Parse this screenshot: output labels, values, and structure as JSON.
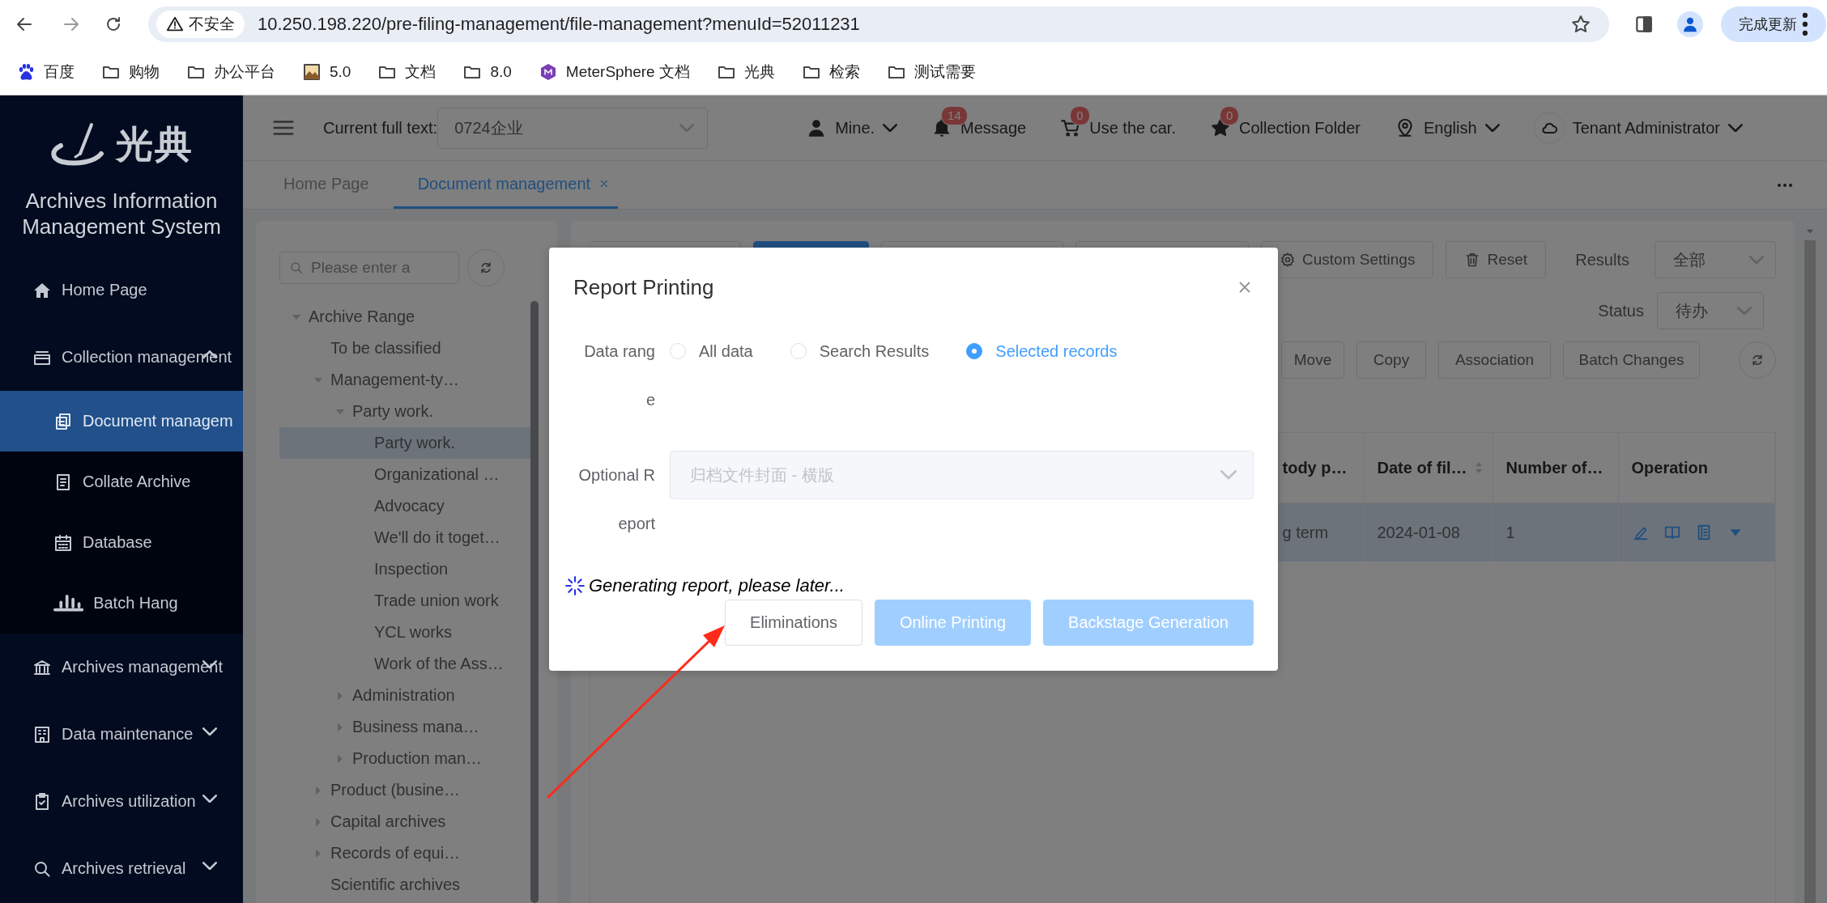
{
  "browser": {
    "security_label": "不安全",
    "url": "10.250.198.220/pre-filing-management/file-management?menuId=52011231",
    "update_button": "完成更新"
  },
  "bookmarks": [
    {
      "label": "百度",
      "kind": "baidu"
    },
    {
      "label": "购物",
      "kind": "folder"
    },
    {
      "label": "办公平台",
      "kind": "folder"
    },
    {
      "label": "5.0",
      "kind": "image"
    },
    {
      "label": "文档",
      "kind": "folder"
    },
    {
      "label": "8.0",
      "kind": "folder"
    },
    {
      "label": "MeterSphere 文档",
      "kind": "app"
    },
    {
      "label": "光典",
      "kind": "folder"
    },
    {
      "label": "检索",
      "kind": "folder"
    },
    {
      "label": "测试需要",
      "kind": "folder"
    }
  ],
  "sidebar": {
    "logo_text": "光典",
    "system_title": "Archives Information Management System",
    "menu": [
      {
        "label": "Home Page",
        "selected": false
      },
      {
        "label": "Collection management",
        "selected": false,
        "expanded": true,
        "children": [
          {
            "label": "Document managem",
            "selected": true
          },
          {
            "label": "Collate Archive",
            "selected": false
          },
          {
            "label": "Database",
            "selected": false
          },
          {
            "label": "Batch Hang",
            "selected": false
          }
        ]
      },
      {
        "label": "Archives management",
        "selected": false,
        "expanded": false
      },
      {
        "label": "Data maintenance",
        "selected": false,
        "expanded": false
      },
      {
        "label": "Archives utilization",
        "selected": false,
        "expanded": false
      },
      {
        "label": "Archives retrieval",
        "selected": false,
        "expanded": false
      }
    ]
  },
  "header": {
    "current_label": "Current full text:",
    "current_value": "0724企业",
    "items": [
      {
        "kind": "user",
        "label": "Mine.",
        "dropdown": true
      },
      {
        "kind": "bell",
        "label": "Message",
        "badge": "14",
        "dropdown": false
      },
      {
        "kind": "cart",
        "label": "Use the car.",
        "badge": "0",
        "dropdown": false
      },
      {
        "kind": "star",
        "label": "Collection Folder",
        "badge": "0",
        "dropdown": false
      },
      {
        "kind": "location",
        "label": "English",
        "dropdown": true
      },
      {
        "kind": "cloud",
        "label": "Tenant Administrator",
        "dropdown": true
      }
    ]
  },
  "tabs": [
    {
      "label": "Home Page",
      "selected": false,
      "closable": false
    },
    {
      "label": "Document management",
      "selected": true,
      "closable": true
    }
  ],
  "tree": {
    "search_placeholder": "Please enter a",
    "nodes": [
      {
        "label": "Archive Range",
        "selected": false,
        "expanded": true,
        "children": [
          {
            "label": "To be classified",
            "selected": false
          },
          {
            "label": "Management-ty…",
            "selected": false,
            "expanded": true,
            "children": [
              {
                "label": "Party work.",
                "selected": false,
                "expanded": true,
                "children": [
                  {
                    "label": "Party work.",
                    "selected": true
                  },
                  {
                    "label": "Organizational …",
                    "selected": false
                  },
                  {
                    "label": "Advocacy",
                    "selected": false
                  },
                  {
                    "label": "We'll do it toget…",
                    "selected": false
                  },
                  {
                    "label": "Inspection",
                    "selected": false
                  },
                  {
                    "label": "Trade union work",
                    "selected": false
                  },
                  {
                    "label": "YCL works",
                    "selected": false
                  },
                  {
                    "label": "Work of the Ass…",
                    "selected": false
                  }
                ]
              },
              {
                "label": "Administration",
                "selected": false,
                "expanded": false
              },
              {
                "label": "Business mana…",
                "selected": false,
                "expanded": false
              },
              {
                "label": "Production man…",
                "selected": false,
                "expanded": false
              }
            ]
          },
          {
            "label": "Product (busine…",
            "selected": false,
            "expanded": false
          },
          {
            "label": "Capital archives",
            "selected": false,
            "expanded": false
          },
          {
            "label": "Records of equi…",
            "selected": false,
            "expanded": false
          },
          {
            "label": "Scientific archives",
            "selected": false
          }
        ]
      }
    ]
  },
  "toolbar": {
    "buttons": [
      "Custom Settings",
      "Reset"
    ],
    "filters": [
      {
        "label": "Results",
        "value": "全部"
      },
      {
        "label": "Status",
        "value": "待办"
      }
    ],
    "actions": [
      "Move",
      "Copy",
      "Association",
      "Batch Changes"
    ]
  },
  "table": {
    "columns": [
      {
        "label": "tody p…",
        "sortable": false
      },
      {
        "label": "Date of fil…",
        "sortable": true
      },
      {
        "label": "Number of…",
        "sortable": false
      },
      {
        "label": "Operation",
        "sortable": false
      }
    ],
    "rows": [
      {
        "selected": true,
        "cells": [
          "g term",
          "2024-01-08",
          "1"
        ]
      }
    ]
  },
  "dialog": {
    "title": "Report Printing",
    "data_range": {
      "label": "Data range",
      "options": [
        {
          "label": "All data",
          "selected": false
        },
        {
          "label": "Search Results",
          "selected": false
        },
        {
          "label": "Selected records",
          "selected": true
        }
      ]
    },
    "report": {
      "label": "Optional Report",
      "value": "归档文件封面 - 横版",
      "disabled": true
    },
    "loading_text": "Generating report, please later...",
    "buttons": [
      {
        "label": "Eliminations",
        "kind": "default",
        "disabled": false
      },
      {
        "label": "Online Printing",
        "kind": "primary",
        "disabled": true
      },
      {
        "label": "Backstage Generation",
        "kind": "primary",
        "disabled": true
      }
    ]
  }
}
